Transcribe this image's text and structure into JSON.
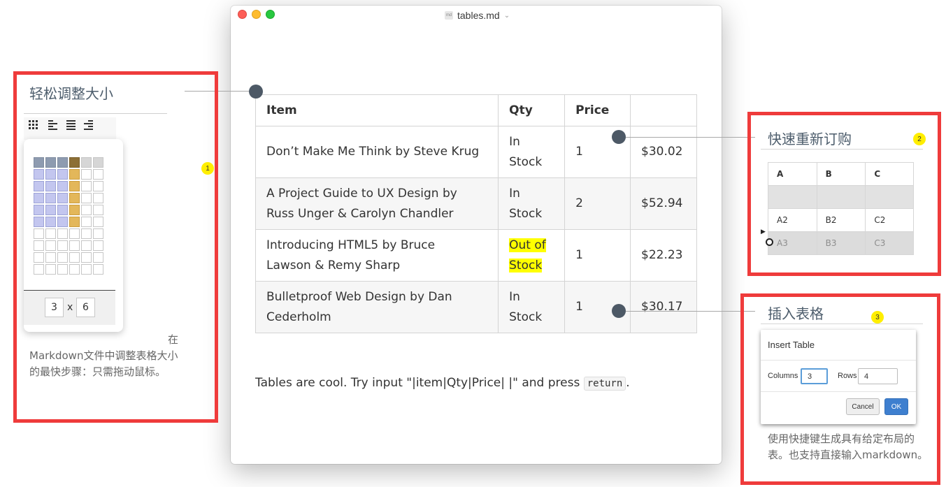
{
  "window": {
    "filename": "tables.md",
    "file_icon_label": "md"
  },
  "table": {
    "headers": [
      "Item",
      "Qty",
      "Price",
      ""
    ],
    "rows": [
      {
        "item_line1": "Don’t Make Me Think by Steve Krug",
        "item_line2": "",
        "qty_line1": "In",
        "qty_line2": "Stock",
        "extra": "1",
        "price": "$30.02"
      },
      {
        "item_line1": "A Project Guide to UX Design by",
        "item_line2": "Russ Unger & Carolyn Chandler",
        "qty_line1": "In",
        "qty_line2": "Stock",
        "extra": "2",
        "price": "$52.94"
      },
      {
        "item_line1": "Introducing HTML5 by Bruce",
        "item_line2": "Lawson & Remy Sharp",
        "qty_line1": "Out of",
        "qty_line2": "Stock",
        "extra": "1",
        "price": "$22.23"
      },
      {
        "item_line1": "Bulletproof Web Design by Dan",
        "item_line2": "Cederholm",
        "qty_line1": "In",
        "qty_line2": "Stock",
        "extra": "1",
        "price": "$30.17"
      }
    ]
  },
  "paragraph": {
    "text": "Tables are cool. Try input \"|item|Qty|Price| |\" and press ",
    "code": "return",
    "end": "."
  },
  "callout1": {
    "title": "轻松调整大小",
    "badge": "1",
    "desc_prefix": "在",
    "desc": "Markdown文件中调整表格大小的最快步骤：只需拖动鼠标。",
    "cols": "3",
    "times": "x",
    "rows": "6"
  },
  "callout2": {
    "title": "快速重新订购",
    "badge": "2",
    "headers": [
      "A",
      "B",
      "C"
    ],
    "row_a2": [
      "A2",
      "B2",
      "C2"
    ],
    "row_a3": [
      "A3",
      "B3",
      "C3"
    ]
  },
  "callout3": {
    "title": "插入表格",
    "badge": "3",
    "dialog_title": "Insert Table",
    "columns_label": "Columns",
    "columns_value": "3",
    "rows_label": "Rows",
    "rows_value": "4",
    "cancel": "Cancel",
    "ok": "OK",
    "desc": "使用快捷键生成具有给定布局的表。也支持直接输入markdown。"
  },
  "colors": {
    "frame": "#ef3b3b",
    "highlight": "#ffff00",
    "badge": "#ffee00",
    "dot": "#4d5966"
  }
}
